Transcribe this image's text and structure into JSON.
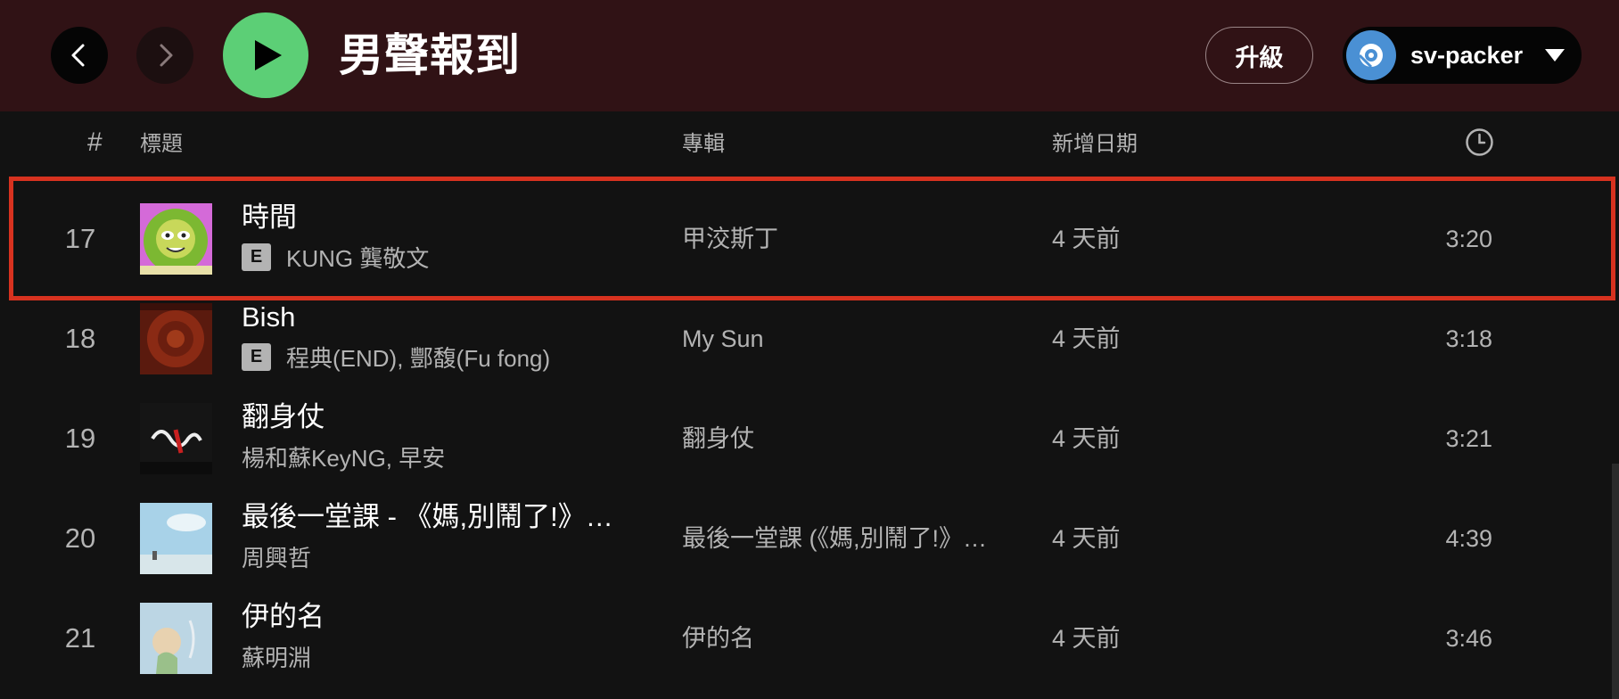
{
  "header": {
    "playlist_title": "男聲報到",
    "upgrade_label": "升級",
    "username": "sv-packer",
    "background_color": "#301215",
    "play_color": "#5ccf76"
  },
  "columns": {
    "number": "#",
    "title": "標題",
    "album": "專輯",
    "date_added": "新增日期",
    "duration_icon": "clock-icon"
  },
  "tracks": [
    {
      "number": "17",
      "title": "時間",
      "explicit": "E",
      "artists": "KUNG 龔敬文",
      "album": "甲洨斯丁",
      "added": "4 天前",
      "duration": "3:20"
    },
    {
      "number": "18",
      "title": "Bish",
      "explicit": "E",
      "artists": "程典(END), 酆馥(Fu fong)",
      "album": "My Sun",
      "added": "4 天前",
      "duration": "3:18"
    },
    {
      "number": "19",
      "title": "翻身仗",
      "explicit": "",
      "artists": "楊和蘇KeyNG, 早安",
      "album": "翻身仗",
      "added": "4 天前",
      "duration": "3:21"
    },
    {
      "number": "20",
      "title": "最後一堂課 - 《媽,別鬧了!》…",
      "explicit": "",
      "artists": "周興哲",
      "album": "最後一堂課 (《媽,別鬧了!》…",
      "added": "4 天前",
      "duration": "4:39"
    },
    {
      "number": "21",
      "title": "伊的名",
      "explicit": "",
      "artists": "蘇明淵",
      "album": "伊的名",
      "added": "4 天前",
      "duration": "3:46"
    }
  ],
  "highlight_color": "#d7321f"
}
